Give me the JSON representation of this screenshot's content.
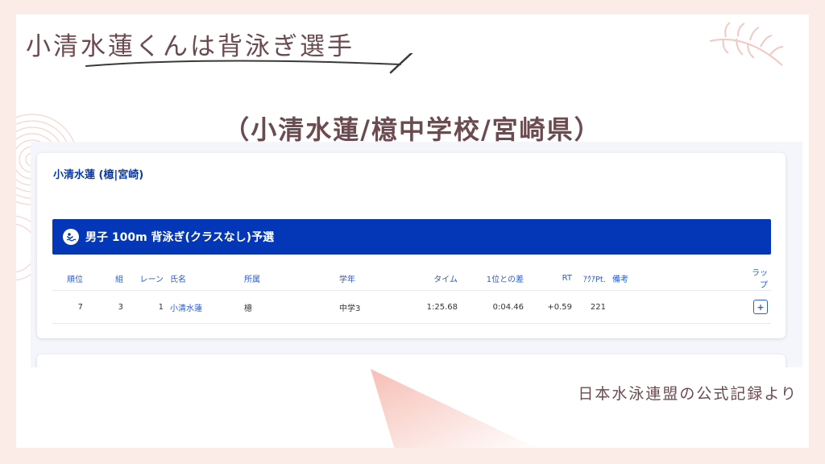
{
  "headline": "小清水蓮くんは背泳ぎ選手",
  "subtitle": "（小清水蓮/檍中学校/宮崎県）",
  "source_note": "日本水泳連盟の公式記録より",
  "athlete_link": "小清水蓮 (檍|宮崎)",
  "event_title": "男子 100m 背泳ぎ(クラスなし)予選",
  "table": {
    "headers": [
      "順位",
      "組",
      "レーン",
      "氏名",
      "所属",
      "学年",
      "タイム",
      "1位との差",
      "RT",
      "ｱｸｱPt.",
      "備考",
      "ラップ"
    ],
    "rows": [
      {
        "rank": "7",
        "heat": "3",
        "lane": "1",
        "name": "小清水蓮",
        "team": "檍",
        "grade": "中学3",
        "time": "1:25.68",
        "diff": "0:04.46",
        "rt": "+0.59",
        "points": "221",
        "note": "",
        "lap": "+"
      }
    ]
  },
  "icons": {
    "event": "swimmer-icon",
    "lap": "plus-icon"
  },
  "colors": {
    "accent_blue": "#0436b8",
    "link_blue": "#2d5bd0",
    "title_brown": "#6b4b4f",
    "background_pink": "#fbece8"
  }
}
